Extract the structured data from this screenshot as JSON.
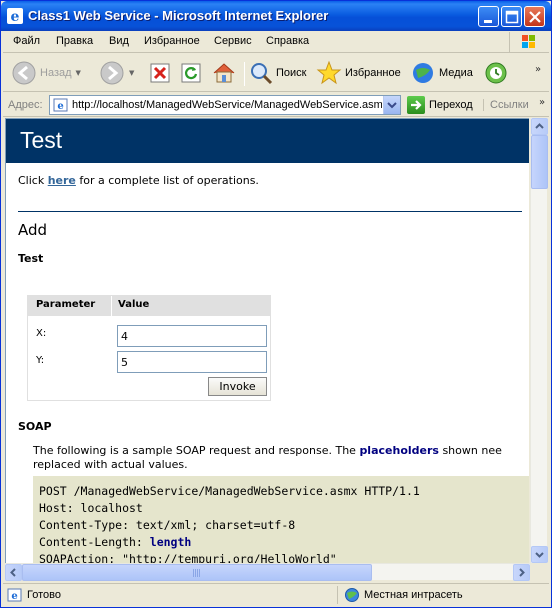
{
  "window": {
    "title": "Class1 Web Service - Microsoft Internet Explorer"
  },
  "menu": {
    "items": [
      "Файл",
      "Правка",
      "Вид",
      "Избранное",
      "Сервис",
      "Справка"
    ]
  },
  "toolbar": {
    "back_label": "Назад",
    "search_label": "Поиск",
    "favorites_label": "Избранное",
    "media_label": "Медиа"
  },
  "address": {
    "label": "Адрес:",
    "url": "http://localhost/ManagedWebService/ManagedWebService.asmx",
    "go_label": "Переход",
    "links_label": "Ссылки"
  },
  "page": {
    "heading": "Test",
    "intro_before": "Click ",
    "intro_link": "here",
    "intro_after": " for a complete list of operations.",
    "operation": "Add",
    "test_heading": "Test",
    "table": {
      "col_parameter": "Parameter",
      "col_value": "Value",
      "params": [
        {
          "label": "X:",
          "value": "4"
        },
        {
          "label": "Y:",
          "value": "5"
        }
      ],
      "invoke_label": "Invoke"
    },
    "soap_heading": "SOAP",
    "soap_intro_1": "The following is a sample SOAP request and response. The ",
    "soap_intro_placeholders": "placeholders",
    "soap_intro_2": " shown nee",
    "soap_intro_line2": "replaced with actual values.",
    "code": {
      "line1": "POST /ManagedWebService/ManagedWebService.asmx HTTP/1.1",
      "line2": "Host: localhost",
      "line3": "Content-Type: text/xml; charset=utf-8",
      "line4_key": "Content-Length: ",
      "line4_val": "length",
      "line5": "SOAPAction: \"http://tempuri.org/HelloWorld\""
    }
  },
  "status": {
    "text": "Готово",
    "zone": "Местная интрасеть"
  }
}
